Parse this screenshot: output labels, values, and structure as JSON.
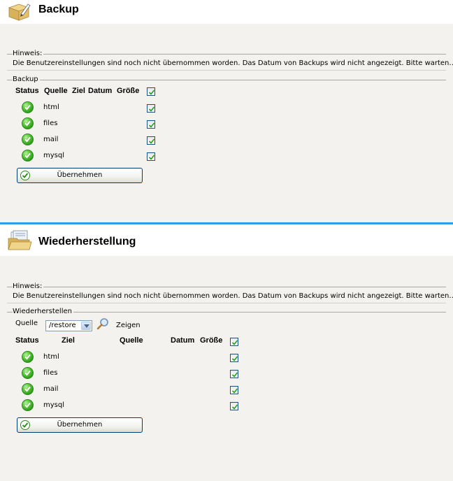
{
  "backup": {
    "title": "Backup",
    "hint_legend": "Hinweis:",
    "hint_text": "Die Benutzereinstellungen sind noch nicht übernommen worden. Das Datum von Backups wird nicht angezeigt. Bitte warten…",
    "group_legend": "Backup",
    "columns": {
      "status": "Status",
      "source": "Quelle",
      "target": "Ziel",
      "date": "Datum",
      "size": "Größe"
    },
    "rows": [
      {
        "label": "html",
        "status": "ok",
        "checked": true
      },
      {
        "label": "files",
        "status": "ok",
        "checked": true
      },
      {
        "label": "mail",
        "status": "ok",
        "checked": true
      },
      {
        "label": "mysql",
        "status": "ok",
        "checked": true
      }
    ],
    "apply_label": "Übernehmen"
  },
  "restore": {
    "title": "Wiederherstellung",
    "hint_legend": "Hinweis:",
    "hint_text": "Die Benutzereinstellungen sind noch nicht übernommen worden. Das Datum von Backups wird nicht angezeigt. Bitte warten…",
    "group_legend": "Wiederherstellen",
    "source_label": "Quelle",
    "source_value": "/restore",
    "show_label": "Zeigen",
    "columns": {
      "status": "Status",
      "target": "Ziel",
      "source": "Quelle",
      "date": "Datum",
      "size": "Größe"
    },
    "rows": [
      {
        "label": "html",
        "status": "ok",
        "checked": true
      },
      {
        "label": "files",
        "status": "ok",
        "checked": true
      },
      {
        "label": "mail",
        "status": "ok",
        "checked": true
      },
      {
        "label": "mysql",
        "status": "ok",
        "checked": true
      }
    ],
    "apply_label": "Übernehmen"
  },
  "colors": {
    "accent_divider": "#2f9fe0",
    "ok_green": "#3fb02a",
    "background": "#f3f2ee"
  },
  "icons": {
    "backup": "box-with-pen-icon",
    "restore": "open-folder-documents-icon",
    "status_ok": "green-check-icon",
    "search": "magnifier-icon"
  }
}
